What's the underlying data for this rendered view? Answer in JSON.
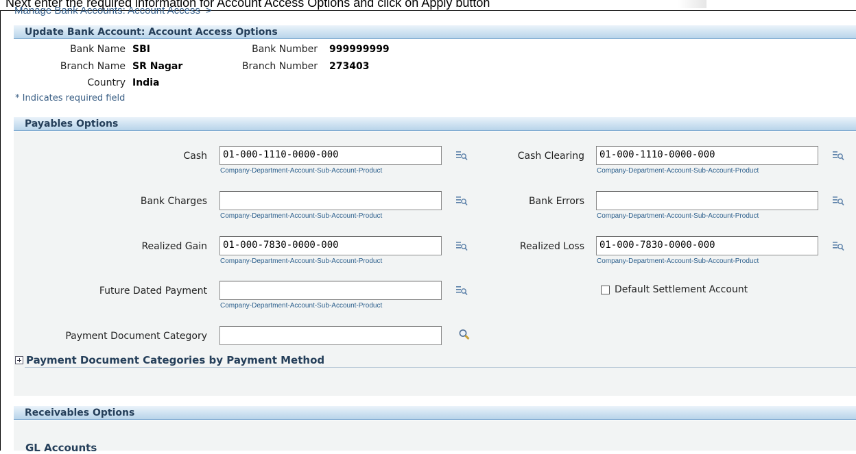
{
  "caption": "Next enter the required information for Account Access Options and click on Apply button",
  "breadcrumb": {
    "link": "Manage Bank Accounts: Account Access",
    "separator": ">"
  },
  "header": {
    "title": "Update Bank Account: Account Access Options"
  },
  "bank_info": {
    "bank_name_label": "Bank Name",
    "bank_name": "SBI",
    "bank_number_label": "Bank Number",
    "bank_number": "999999999",
    "branch_name_label": "Branch Name",
    "branch_name": "SR Nagar",
    "branch_number_label": "Branch Number",
    "branch_number": "273403",
    "country_label": "Country",
    "country": "India"
  },
  "required_note": "* Indicates required field",
  "payables": {
    "title": "Payables Options",
    "hint": "Company-Department-Account-Sub-Account-Product",
    "cash_label": "Cash",
    "cash_value": "01-000-1110-0000-000",
    "cash_clearing_label": "Cash Clearing",
    "cash_clearing_value": "01-000-1110-0000-000",
    "bank_charges_label": "Bank Charges",
    "bank_charges_value": "",
    "bank_errors_label": "Bank Errors",
    "bank_errors_value": "",
    "realized_gain_label": "Realized Gain",
    "realized_gain_value": "01-000-7830-0000-000",
    "realized_loss_label": "Realized Loss",
    "realized_loss_value": "01-000-7830-0000-000",
    "future_dated_label": "Future Dated Payment",
    "future_dated_value": "",
    "default_settlement_label": "Default Settlement Account",
    "payment_doc_category_label": "Payment Document Category",
    "payment_doc_category_value": "",
    "categories_by_method": "Payment Document Categories by Payment Method"
  },
  "receivables": {
    "title": "Receivables Options",
    "gl_accounts": "GL Accounts"
  }
}
